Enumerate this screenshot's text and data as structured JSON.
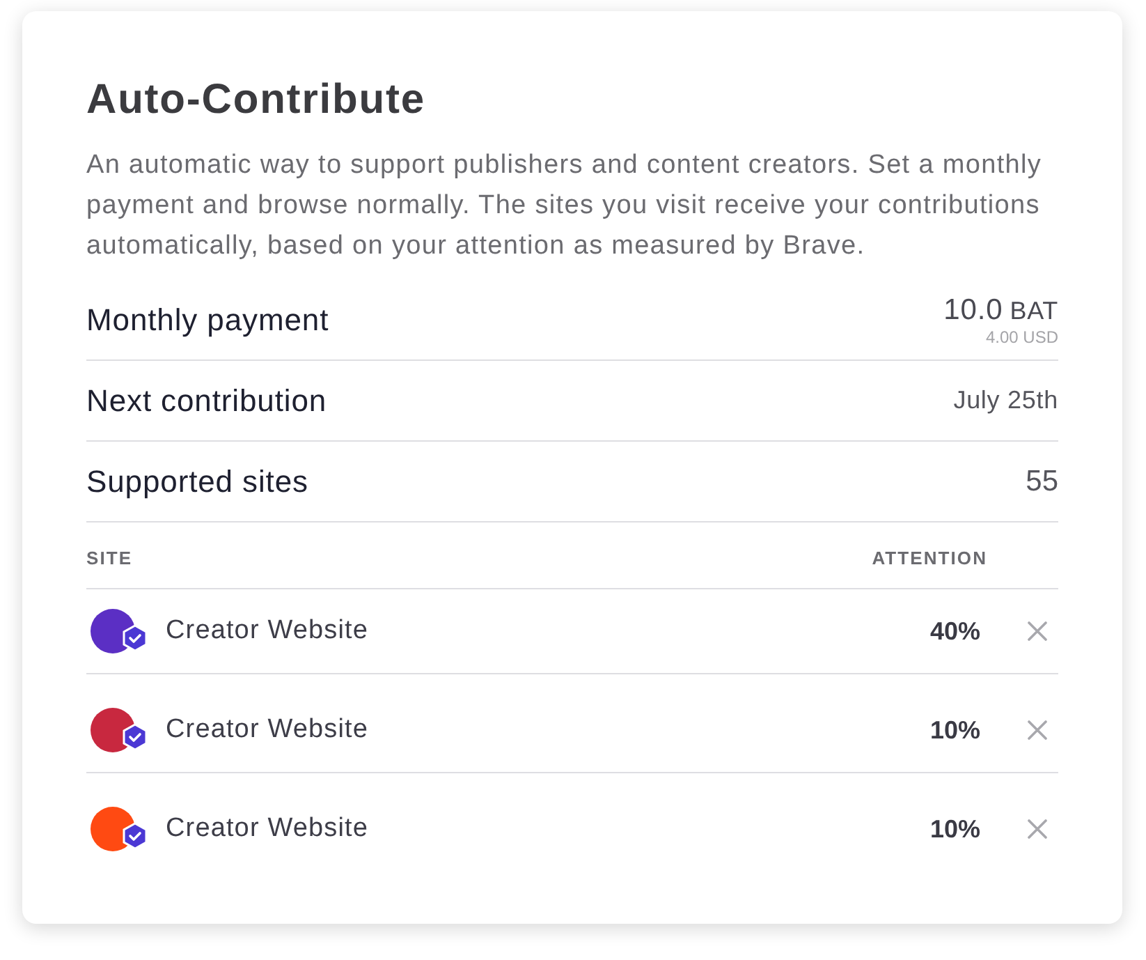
{
  "card": {
    "title": "Auto-Contribute",
    "description": "An automatic way to support publishers and content creators. Set a monthly payment and browse normally. The sites you visit receive your contributions automatically, based on your attention as measured by Brave."
  },
  "summary": [
    {
      "kind": "amount",
      "label": "Monthly payment",
      "value": "10.0",
      "unit": "BAT",
      "secondary": "4.00 USD"
    },
    {
      "kind": "date",
      "label": "Next contribution",
      "value": "July 25th"
    },
    {
      "kind": "count",
      "label": "Supported sites",
      "value": "55"
    }
  ],
  "table": {
    "columns": [
      "SITE",
      "ATTENTION"
    ],
    "rows": [
      {
        "name": "Creator Website",
        "color": "#5b2fc4",
        "verified": true,
        "attention": "40%"
      },
      {
        "name": "Creator Website",
        "color": "#c8283f",
        "verified": true,
        "attention": "10%"
      },
      {
        "name": "Creator Website",
        "color": "#ff4a12",
        "verified": true,
        "attention": "10%"
      }
    ]
  }
}
